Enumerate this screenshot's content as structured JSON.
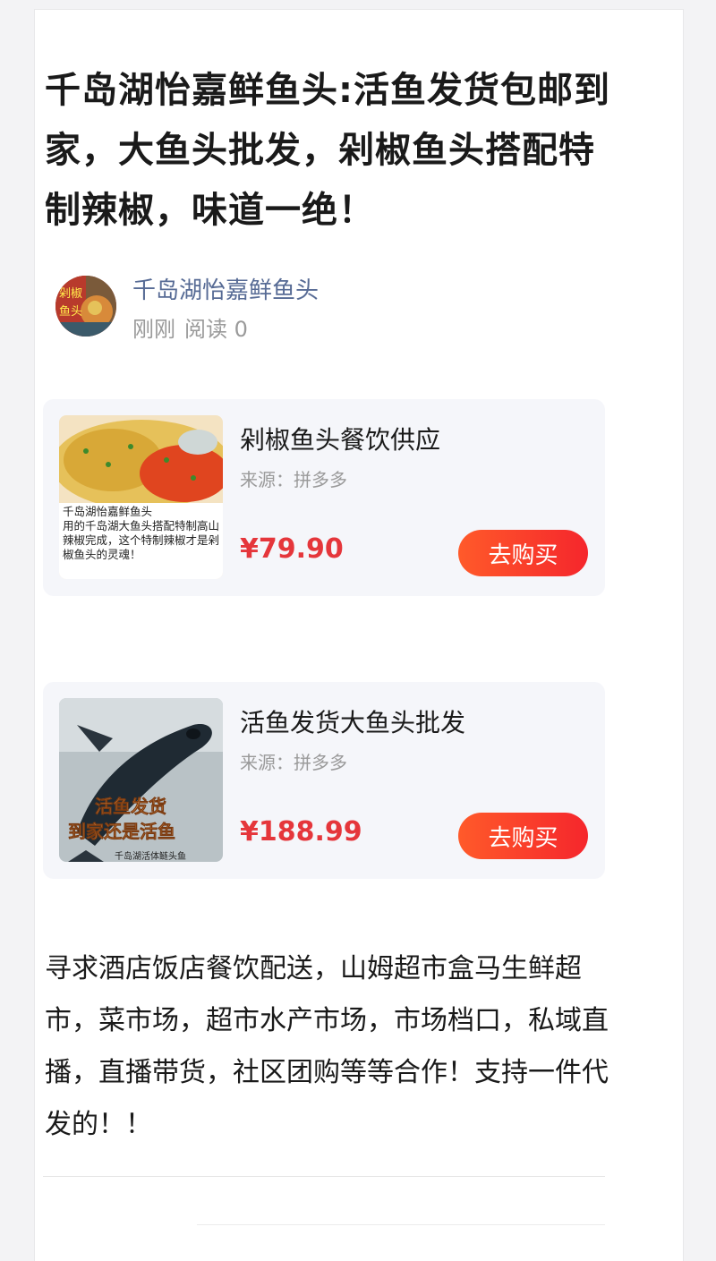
{
  "article": {
    "title": "千岛湖怡嘉鲜鱼头:活鱼发货包邮到家，大鱼头批发，剁椒鱼头搭配特制辣椒，味道一绝！",
    "author_name": "千岛湖怡嘉鲜鱼头",
    "time": "刚刚",
    "reads": "阅读 0",
    "body": "寻求酒店饭店餐饮配送，山姆超市盒马生鲜超市，菜市场，超市水产市场，市场档口，私域直播，直播带货，社区团购等等合作！支持一件代发的！！"
  },
  "avatar": {
    "text_top": "剁椒",
    "text_bottom": "鱼头"
  },
  "products": [
    {
      "name": "剁椒鱼头餐饮供应",
      "source": "来源：拼多多",
      "price": "¥79.90",
      "buy_label": "去购买",
      "image_caption": "千岛湖怡嘉鲜鱼头\n用的千岛湖大鱼头搭配特制高山辣椒完成，这个特制辣椒才是剁椒鱼头的灵魂！"
    },
    {
      "name": "活鱼发货大鱼头批发",
      "source": "来源：拼多多",
      "price": "¥188.99",
      "buy_label": "去购买",
      "image_caption_1": "活鱼发货",
      "image_caption_2": "到家还是活鱼",
      "image_footer": "千岛湖活体鲢头鱼"
    }
  ],
  "colors": {
    "price": "#e5363b",
    "author": "#576b95",
    "buy_button": "#f5262c"
  }
}
